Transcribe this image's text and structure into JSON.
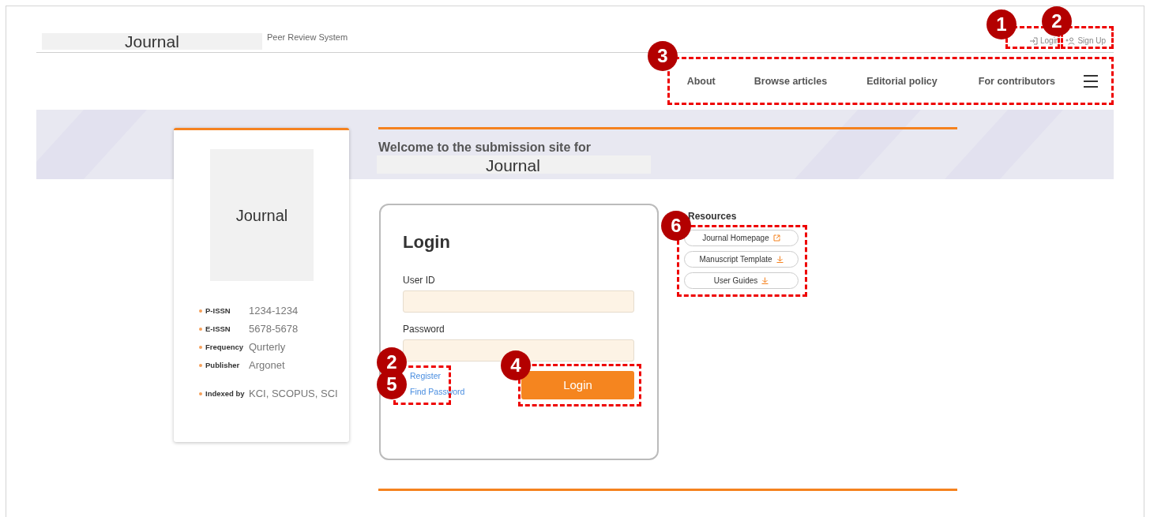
{
  "header": {
    "logo": "Journal",
    "subtitle": "Peer Review System",
    "account_links": [
      {
        "kind": "login",
        "label": "Login"
      },
      {
        "kind": "signup",
        "label": "Sign Up"
      }
    ]
  },
  "nav": {
    "items": [
      "About",
      "Browse articles",
      "Editorial policy",
      "For contributors"
    ]
  },
  "banner": {
    "title": "Welcome to the submission site for",
    "journal": "Journal"
  },
  "journal_card": {
    "cover": "Journal",
    "info": [
      {
        "label": "P-ISSN",
        "value": "1234-1234"
      },
      {
        "label": "E-ISSN",
        "value": "5678-5678"
      },
      {
        "label": "Frequency",
        "value": "Qurterly"
      },
      {
        "label": "Publisher",
        "value": "Argonet"
      },
      {
        "label": "Indexed by",
        "value": "KCI, SCOPUS, SCI"
      }
    ]
  },
  "login": {
    "title": "Login",
    "fields": [
      {
        "label": "User ID"
      },
      {
        "label": "Password"
      }
    ],
    "links": [
      "Register",
      "Find Password"
    ],
    "button": "Login"
  },
  "resources": {
    "title": "Resources",
    "items": [
      {
        "label": "Journal Homepage",
        "kind": "external"
      },
      {
        "label": "Manuscript Template",
        "kind": "download"
      },
      {
        "label": "User Guides",
        "kind": "download"
      }
    ]
  },
  "callouts": [
    "1",
    "2",
    "3",
    "2",
    "5",
    "4",
    "6"
  ]
}
